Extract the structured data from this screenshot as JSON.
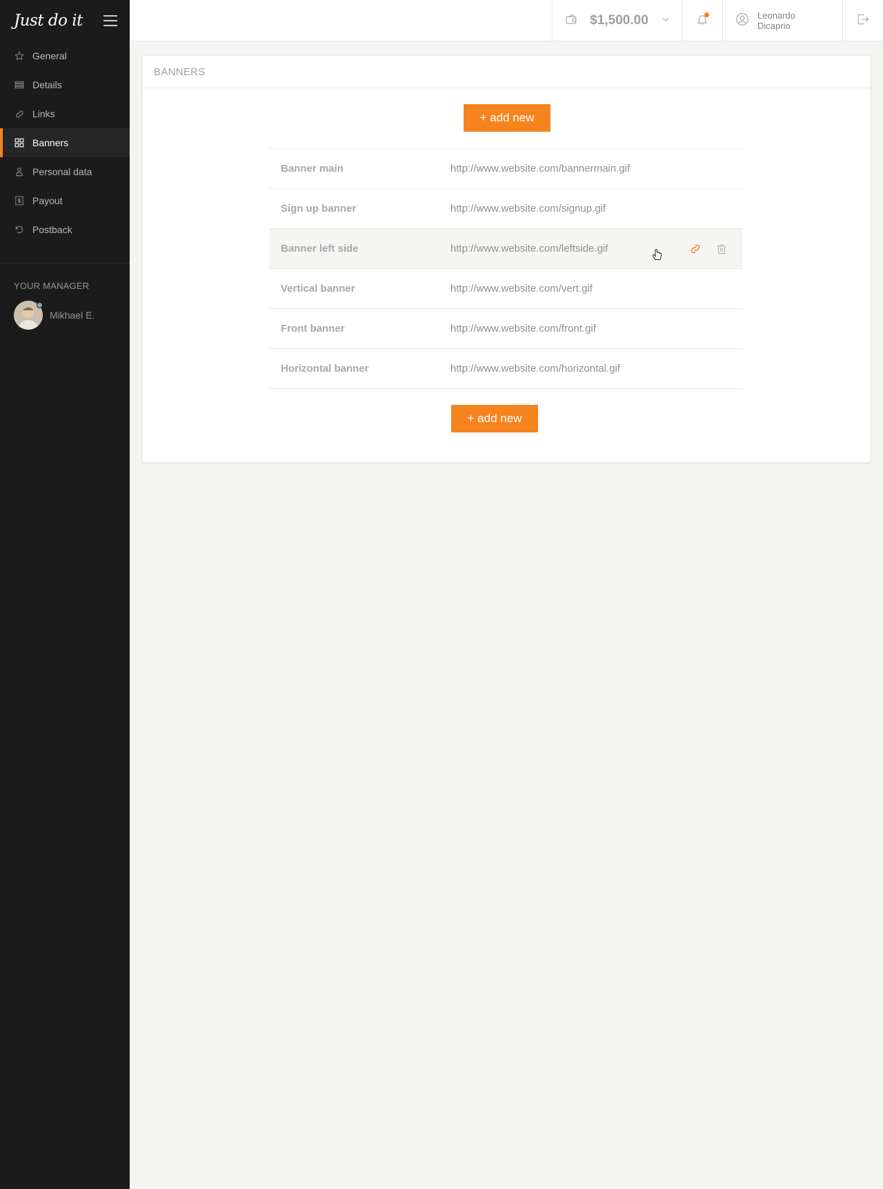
{
  "brand": {
    "logo_text": "Just do it"
  },
  "sidebar": {
    "items": [
      {
        "label": "General",
        "icon": "star-icon"
      },
      {
        "label": "Details",
        "icon": "list-icon"
      },
      {
        "label": "Links",
        "icon": "link-icon"
      },
      {
        "label": "Banners",
        "icon": "grid-icon",
        "active": true
      },
      {
        "label": "Personal data",
        "icon": "user-icon"
      },
      {
        "label": "Payout",
        "icon": "dollar-icon"
      },
      {
        "label": "Postback",
        "icon": "undo-icon"
      }
    ],
    "manager_title": "YOUR MANAGER",
    "manager_name": "Mikhael E."
  },
  "topbar": {
    "balance": "$1,500.00",
    "user_name": "Leonardo Dicaprio",
    "has_notification": true
  },
  "panel": {
    "title": "BANNERS",
    "add_label": "+ add new",
    "rows": [
      {
        "name": "Banner main",
        "url": "http://www.website.com/bannermain.gif"
      },
      {
        "name": "Sign up banner",
        "url": "http://www.website.com/signup.gif"
      },
      {
        "name": "Banner left side",
        "url": "http://www.website.com/leftside.gif",
        "hover": true
      },
      {
        "name": "Vertical banner",
        "url": "http://www.website.com/vert.gif"
      },
      {
        "name": "Front banner",
        "url": "http://www.website.com/front.gif"
      },
      {
        "name": "Horizontal banner",
        "url": "http://www.website.com/horizontal.gif"
      }
    ]
  },
  "colors": {
    "accent": "#f5841f",
    "sidebar_bg": "#1b1b1b",
    "page_bg": "#f4f4f1"
  }
}
